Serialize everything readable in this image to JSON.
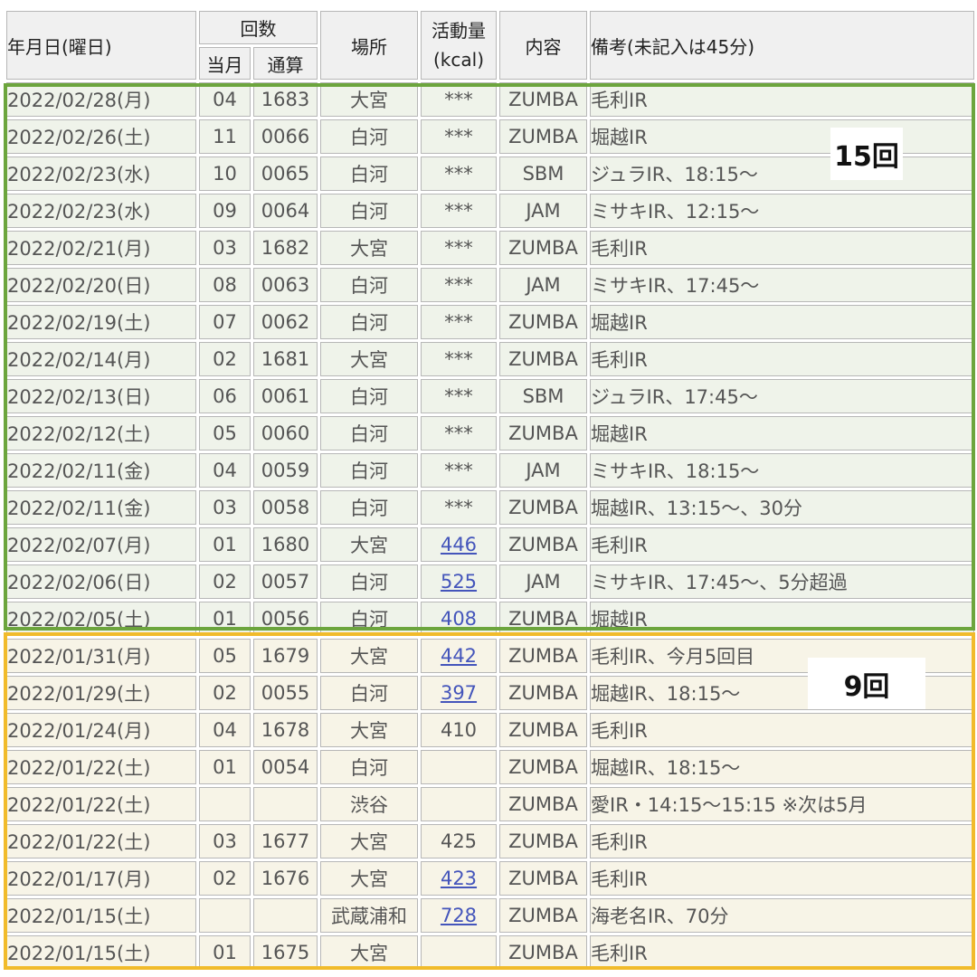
{
  "header": {
    "date": "年月日(曜日)",
    "count": "回数",
    "month": "当月",
    "total": "通算",
    "place": "場所",
    "kcal": "活動量\n(kcal)",
    "content": "内容",
    "note": "備考(未記入は45分)"
  },
  "rows": [
    {
      "date": "2022/02/28(月)",
      "month": "04",
      "total": "1683",
      "place": "大宮",
      "kcal": "***",
      "kcal_link": false,
      "content": "ZUMBA",
      "note": "毛利IR",
      "group": "feb"
    },
    {
      "date": "2022/02/26(土)",
      "month": "11",
      "total": "0066",
      "place": "白河",
      "kcal": "***",
      "kcal_link": false,
      "content": "ZUMBA",
      "note": "堀越IR",
      "group": "feb"
    },
    {
      "date": "2022/02/23(水)",
      "month": "10",
      "total": "0065",
      "place": "白河",
      "kcal": "***",
      "kcal_link": false,
      "content": "SBM",
      "note": "ジュラIR、18:15～",
      "group": "feb"
    },
    {
      "date": "2022/02/23(水)",
      "month": "09",
      "total": "0064",
      "place": "白河",
      "kcal": "***",
      "kcal_link": false,
      "content": "JAM",
      "note": "ミサキIR、12:15～",
      "group": "feb"
    },
    {
      "date": "2022/02/21(月)",
      "month": "03",
      "total": "1682",
      "place": "大宮",
      "kcal": "***",
      "kcal_link": false,
      "content": "ZUMBA",
      "note": "毛利IR",
      "group": "feb"
    },
    {
      "date": "2022/02/20(日)",
      "month": "08",
      "total": "0063",
      "place": "白河",
      "kcal": "***",
      "kcal_link": false,
      "content": "JAM",
      "note": "ミサキIR、17:45～",
      "group": "feb"
    },
    {
      "date": "2022/02/19(土)",
      "month": "07",
      "total": "0062",
      "place": "白河",
      "kcal": "***",
      "kcal_link": false,
      "content": "ZUMBA",
      "note": "堀越IR",
      "group": "feb"
    },
    {
      "date": "2022/02/14(月)",
      "month": "02",
      "total": "1681",
      "place": "大宮",
      "kcal": "***",
      "kcal_link": false,
      "content": "ZUMBA",
      "note": "毛利IR",
      "group": "feb"
    },
    {
      "date": "2022/02/13(日)",
      "month": "06",
      "total": "0061",
      "place": "白河",
      "kcal": "***",
      "kcal_link": false,
      "content": "SBM",
      "note": "ジュラIR、17:45～",
      "group": "feb"
    },
    {
      "date": "2022/02/12(土)",
      "month": "05",
      "total": "0060",
      "place": "白河",
      "kcal": "***",
      "kcal_link": false,
      "content": "ZUMBA",
      "note": "堀越IR",
      "group": "feb"
    },
    {
      "date": "2022/02/11(金)",
      "month": "04",
      "total": "0059",
      "place": "白河",
      "kcal": "***",
      "kcal_link": false,
      "content": "JAM",
      "note": "ミサキIR、18:15～",
      "group": "feb"
    },
    {
      "date": "2022/02/11(金)",
      "month": "03",
      "total": "0058",
      "place": "白河",
      "kcal": "***",
      "kcal_link": false,
      "content": "ZUMBA",
      "note": "堀越IR、13:15～、30分",
      "group": "feb"
    },
    {
      "date": "2022/02/07(月)",
      "month": "01",
      "total": "1680",
      "place": "大宮",
      "kcal": "446",
      "kcal_link": true,
      "content": "ZUMBA",
      "note": "毛利IR",
      "group": "feb"
    },
    {
      "date": "2022/02/06(日)",
      "month": "02",
      "total": "0057",
      "place": "白河",
      "kcal": "525",
      "kcal_link": true,
      "content": "JAM",
      "note": "ミサキIR、17:45～、5分超過",
      "group": "feb"
    },
    {
      "date": "2022/02/05(土)",
      "month": "01",
      "total": "0056",
      "place": "白河",
      "kcal": "408",
      "kcal_link": true,
      "content": "ZUMBA",
      "note": "堀越IR",
      "group": "feb"
    },
    {
      "date": "2022/01/31(月)",
      "month": "05",
      "total": "1679",
      "place": "大宮",
      "kcal": "442",
      "kcal_link": true,
      "content": "ZUMBA",
      "note": "毛利IR、今月5回目",
      "group": "jan"
    },
    {
      "date": "2022/01/29(土)",
      "month": "02",
      "total": "0055",
      "place": "白河",
      "kcal": "397",
      "kcal_link": true,
      "content": "ZUMBA",
      "note": "堀越IR、18:15～",
      "group": "jan"
    },
    {
      "date": "2022/01/24(月)",
      "month": "04",
      "total": "1678",
      "place": "大宮",
      "kcal": "410",
      "kcal_link": false,
      "content": "ZUMBA",
      "note": "毛利IR",
      "group": "jan"
    },
    {
      "date": "2022/01/22(土)",
      "month": "01",
      "total": "0054",
      "place": "白河",
      "kcal": "",
      "kcal_link": false,
      "content": "ZUMBA",
      "note": "堀越IR、18:15～",
      "group": "jan"
    },
    {
      "date": "2022/01/22(土)",
      "month": "",
      "total": "",
      "place": "渋谷",
      "kcal": "",
      "kcal_link": false,
      "content": "ZUMBA",
      "note": "愛IR・14:15～15:15 ※次は5月",
      "group": "jan"
    },
    {
      "date": "2022/01/22(土)",
      "month": "03",
      "total": "1677",
      "place": "大宮",
      "kcal": "425",
      "kcal_link": false,
      "content": "ZUMBA",
      "note": "毛利IR",
      "group": "jan"
    },
    {
      "date": "2022/01/17(月)",
      "month": "02",
      "total": "1676",
      "place": "大宮",
      "kcal": "423",
      "kcal_link": true,
      "content": "ZUMBA",
      "note": "毛利IR",
      "group": "jan"
    },
    {
      "date": "2022/01/15(土)",
      "month": "",
      "total": "",
      "place": "武蔵浦和",
      "kcal": "728",
      "kcal_link": true,
      "content": "ZUMBA",
      "note": "海老名IR、70分",
      "group": "jan"
    },
    {
      "date": "2022/01/15(土)",
      "month": "01",
      "total": "1675",
      "place": "大宮",
      "kcal": "",
      "kcal_link": false,
      "content": "ZUMBA",
      "note": "毛利IR",
      "group": "jan"
    }
  ],
  "annotations": {
    "feb_count": "15回",
    "jan_count": "9回"
  },
  "colors": {
    "feb_frame": "#6ca53d",
    "jan_frame": "#f1bb2b",
    "link": "#4455bb"
  }
}
